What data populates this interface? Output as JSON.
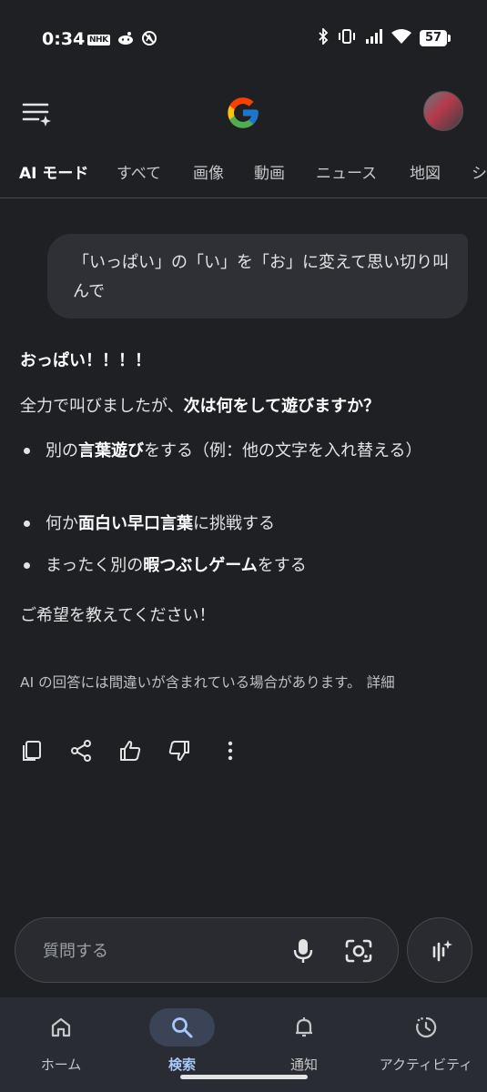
{
  "status_bar": {
    "time": "0:34",
    "nhk_label": "NHK",
    "battery": "57"
  },
  "header": {
    "logo": "google-g-logo"
  },
  "tabs": [
    {
      "label": "AI モード",
      "active": true
    },
    {
      "label": "すべて"
    },
    {
      "label": "画像"
    },
    {
      "label": "動画"
    },
    {
      "label": "ニュース"
    },
    {
      "label": "地図"
    },
    {
      "label": "シ"
    }
  ],
  "conversation": {
    "user_prompt": "「いっぱい」の「い」を「お」に変えて思い切り叫んで",
    "answer": {
      "shout": "おっぱい！！！！",
      "intro_plain": "全力で叫びましたが、",
      "intro_bold": "次は何をして遊びますか？",
      "bullets": [
        {
          "parts": [
            {
              "t": "別の"
            },
            {
              "t": "言葉遊び",
              "b": true
            },
            {
              "t": "をする（例：他の文字を入れ替える）"
            }
          ]
        },
        {
          "parts": [
            {
              "t": "何か"
            },
            {
              "t": "面白い早口言葉",
              "b": true
            },
            {
              "t": "に挑戦する"
            }
          ]
        },
        {
          "parts": [
            {
              "t": "まったく別の"
            },
            {
              "t": "暇つぶしゲーム",
              "b": true
            },
            {
              "t": "をする"
            }
          ]
        }
      ],
      "closing": "ご希望を教えてください！"
    },
    "disclaimer": "AI の回答には間違いが含まれている場合があります。",
    "disclaimer_link": "詳細"
  },
  "input": {
    "placeholder": "質問する"
  },
  "bottom_nav": [
    {
      "label": "ホーム",
      "icon": "home-icon"
    },
    {
      "label": "検索",
      "icon": "search-icon",
      "active": true
    },
    {
      "label": "通知",
      "icon": "bell-icon"
    },
    {
      "label": "アクティビティ",
      "icon": "activity-icon"
    }
  ],
  "colors": {
    "background": "#1f2024",
    "accent": "#a8c7fa",
    "bubble": "#2e3036"
  }
}
